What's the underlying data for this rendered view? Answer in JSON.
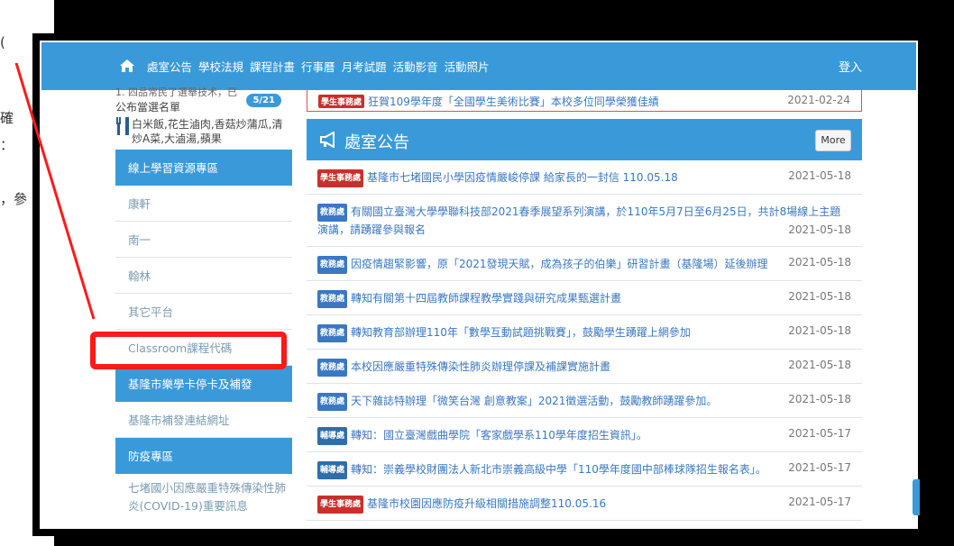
{
  "navbar": {
    "items": [
      "處室公告",
      "學校法規",
      "課程計畫",
      "行事曆",
      "月考試題",
      "活動影音",
      "活動照片"
    ],
    "login": "登入"
  },
  "underlay": {
    "fragments": [
      "(",
      "確",
      "：",
      "，參"
    ]
  },
  "sidebar": {
    "partial_top": "1. 四品常民了選舉技术，已",
    "announce": "公布當選名單",
    "badge": "5/21",
    "lunch_menu": "白米飯,花生滷肉,香菇炒蒲瓜,清炒A菜,大滷湯,蘋果",
    "items": [
      {
        "label": "線上學習資源專區",
        "style": "blue"
      },
      {
        "label": "康軒",
        "style": "plain"
      },
      {
        "label": "南一",
        "style": "plain"
      },
      {
        "label": "翰林",
        "style": "plain"
      },
      {
        "label": "其它平台",
        "style": "plain"
      },
      {
        "label": "Classroom課程代碼",
        "style": "plain"
      },
      {
        "label": "基隆市樂學卡停卡及補發",
        "style": "blue"
      },
      {
        "label": "基隆市補發連結網址",
        "style": "plain"
      },
      {
        "label": "防疫專區",
        "style": "blue"
      }
    ],
    "covid_note": "七堵國小因應嚴重特殊傳染性肺炎(COVID-19)重要訊息"
  },
  "top_news": {
    "tag": "學生事務處",
    "text": "狂賀109學年度「全國學生美術比賽」本校多位同學榮獲佳績",
    "date": "2021-02-24"
  },
  "panel": {
    "title": "處室公告",
    "more_label": "More"
  },
  "announcements": [
    {
      "tag": "學生事務處",
      "tag_color": "red",
      "text": "基隆市七堵國民小學因疫情嚴峻停課 給家長的一封信 110.05.18",
      "date": "2021-05-18"
    },
    {
      "tag": "教務處",
      "tag_color": "blue",
      "text": "有關國立臺灣大學學聯科技部2021春季展望系列演講，於110年5月7日至6月25日，共計8場線上主題演講，請踴躍參與報名",
      "date": "2021-05-18"
    },
    {
      "tag": "教務處",
      "tag_color": "blue",
      "text": "因疫情趨緊影響，原「2021發現天賦，成為孩子的伯樂」研習計畫（基隆場）延後辦理",
      "date": "2021-05-18"
    },
    {
      "tag": "教務處",
      "tag_color": "blue",
      "text": "轉知有關第十四屆教師課程教學實踐與研究成果甄選計畫",
      "date": "2021-05-18"
    },
    {
      "tag": "教務處",
      "tag_color": "blue",
      "text": "轉知教育部辦理110年「數學互動試題挑戰賽」，鼓勵學生踴躍上網參加",
      "date": "2021-05-18"
    },
    {
      "tag": "教務處",
      "tag_color": "blue",
      "text": "本校因應嚴重特殊傳染性肺炎辦理停課及補課實施計畫",
      "date": "2021-05-18"
    },
    {
      "tag": "教務處",
      "tag_color": "blue",
      "text": "天下雜誌特辦理「微笑台灣 創意教案」2021徵選活動，鼓勵教師踴躍參加。",
      "date": "2021-05-18"
    },
    {
      "tag": "輔導處",
      "tag_color": "navy",
      "text": "轉知：國立臺灣戲曲學院「客家戲學系110學年度招生資訊」。",
      "date": "2021-05-17"
    },
    {
      "tag": "輔導處",
      "tag_color": "navy",
      "text": "轉知：崇義學校財團法人新北市崇義高級中學「110學年度國中部棒球隊招生報名表」。",
      "date": "2021-05-17"
    },
    {
      "tag": "學生事務處",
      "tag_color": "red",
      "text": "基隆市校園因應防疫升級相關措施調整110.05.16",
      "date": "2021-05-17"
    }
  ]
}
